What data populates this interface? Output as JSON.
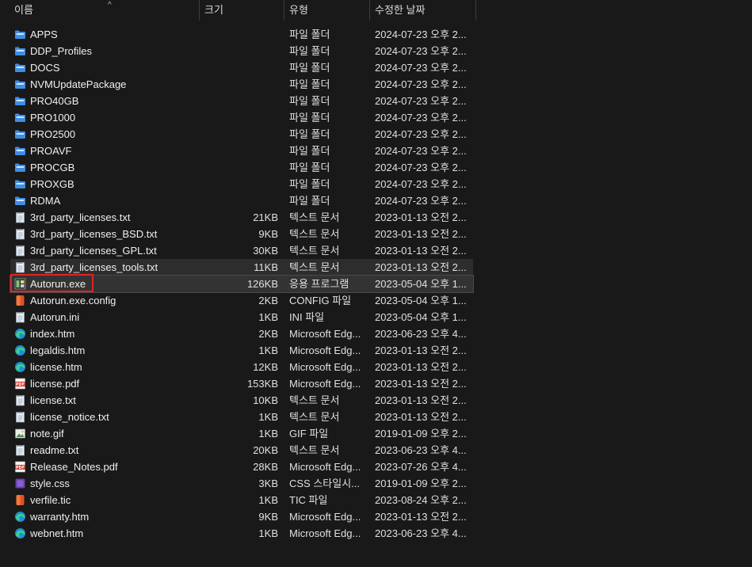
{
  "columns": {
    "name": "이름",
    "size": "크기",
    "type": "유형",
    "date": "수정한 날짜",
    "sort_indicator": "^"
  },
  "colors": {
    "folder": "#4a90e2",
    "highlight_border": "#e02424",
    "selected_bg": "#333333"
  },
  "files": [
    {
      "name": "APPS",
      "size": "",
      "type": "파일 폴더",
      "date": "2024-07-23 오후 2...",
      "icon": "folder-icon"
    },
    {
      "name": "DDP_Profiles",
      "size": "",
      "type": "파일 폴더",
      "date": "2024-07-23 오후 2...",
      "icon": "folder-icon"
    },
    {
      "name": "DOCS",
      "size": "",
      "type": "파일 폴더",
      "date": "2024-07-23 오후 2...",
      "icon": "folder-icon"
    },
    {
      "name": "NVMUpdatePackage",
      "size": "",
      "type": "파일 폴더",
      "date": "2024-07-23 오후 2...",
      "icon": "folder-icon"
    },
    {
      "name": "PRO40GB",
      "size": "",
      "type": "파일 폴더",
      "date": "2024-07-23 오후 2...",
      "icon": "folder-icon"
    },
    {
      "name": "PRO1000",
      "size": "",
      "type": "파일 폴더",
      "date": "2024-07-23 오후 2...",
      "icon": "folder-icon"
    },
    {
      "name": "PRO2500",
      "size": "",
      "type": "파일 폴더",
      "date": "2024-07-23 오후 2...",
      "icon": "folder-icon"
    },
    {
      "name": "PROAVF",
      "size": "",
      "type": "파일 폴더",
      "date": "2024-07-23 오후 2...",
      "icon": "folder-icon"
    },
    {
      "name": "PROCGB",
      "size": "",
      "type": "파일 폴더",
      "date": "2024-07-23 오후 2...",
      "icon": "folder-icon"
    },
    {
      "name": "PROXGB",
      "size": "",
      "type": "파일 폴더",
      "date": "2024-07-23 오후 2...",
      "icon": "folder-icon"
    },
    {
      "name": "RDMA",
      "size": "",
      "type": "파일 폴더",
      "date": "2024-07-23 오후 2...",
      "icon": "folder-icon"
    },
    {
      "name": "3rd_party_licenses.txt",
      "size": "21KB",
      "type": "텍스트 문서",
      "date": "2023-01-13 오전 2...",
      "icon": "text-file-icon"
    },
    {
      "name": "3rd_party_licenses_BSD.txt",
      "size": "9KB",
      "type": "텍스트 문서",
      "date": "2023-01-13 오전 2...",
      "icon": "text-file-icon"
    },
    {
      "name": "3rd_party_licenses_GPL.txt",
      "size": "30KB",
      "type": "텍스트 문서",
      "date": "2023-01-13 오전 2...",
      "icon": "text-file-icon"
    },
    {
      "name": "3rd_party_licenses_tools.txt",
      "size": "11KB",
      "type": "텍스트 문서",
      "date": "2023-01-13 오전 2...",
      "icon": "text-file-icon",
      "state": "hover"
    },
    {
      "name": "Autorun.exe",
      "size": "126KB",
      "type": "응용 프로그램",
      "date": "2023-05-04 오후 1...",
      "icon": "application-icon",
      "state": "selected",
      "highlighted": true
    },
    {
      "name": "Autorun.exe.config",
      "size": "2KB",
      "type": "CONFIG 파일",
      "date": "2023-05-04 오후 1...",
      "icon": "config-file-icon"
    },
    {
      "name": "Autorun.ini",
      "size": "1KB",
      "type": "INI 파일",
      "date": "2023-05-04 오후 1...",
      "icon": "text-file-icon"
    },
    {
      "name": "index.htm",
      "size": "2KB",
      "type": "Microsoft Edg...",
      "date": "2023-06-23 오후 4...",
      "icon": "edge-icon"
    },
    {
      "name": "legaldis.htm",
      "size": "1KB",
      "type": "Microsoft Edg...",
      "date": "2023-01-13 오전 2...",
      "icon": "edge-icon"
    },
    {
      "name": "license.htm",
      "size": "12KB",
      "type": "Microsoft Edg...",
      "date": "2023-01-13 오전 2...",
      "icon": "edge-icon"
    },
    {
      "name": "license.pdf",
      "size": "153KB",
      "type": "Microsoft Edg...",
      "date": "2023-01-13 오전 2...",
      "icon": "pdf-icon"
    },
    {
      "name": "license.txt",
      "size": "10KB",
      "type": "텍스트 문서",
      "date": "2023-01-13 오전 2...",
      "icon": "text-file-icon"
    },
    {
      "name": "license_notice.txt",
      "size": "1KB",
      "type": "텍스트 문서",
      "date": "2023-01-13 오전 2...",
      "icon": "text-file-icon"
    },
    {
      "name": "note.gif",
      "size": "1KB",
      "type": "GIF 파일",
      "date": "2019-01-09 오후 2...",
      "icon": "image-icon"
    },
    {
      "name": "readme.txt",
      "size": "20KB",
      "type": "텍스트 문서",
      "date": "2023-06-23 오후 4...",
      "icon": "text-file-icon"
    },
    {
      "name": "Release_Notes.pdf",
      "size": "28KB",
      "type": "Microsoft Edg...",
      "date": "2023-07-26 오후 4...",
      "icon": "pdf-icon"
    },
    {
      "name": "style.css",
      "size": "3KB",
      "type": "CSS 스타일시...",
      "date": "2019-01-09 오후 2...",
      "icon": "css-file-icon"
    },
    {
      "name": "verfile.tic",
      "size": "1KB",
      "type": "TIC 파일",
      "date": "2023-08-24 오후 2...",
      "icon": "config-file-icon"
    },
    {
      "name": "warranty.htm",
      "size": "9KB",
      "type": "Microsoft Edg...",
      "date": "2023-01-13 오전 2...",
      "icon": "edge-icon"
    },
    {
      "name": "webnet.htm",
      "size": "1KB",
      "type": "Microsoft Edg...",
      "date": "2023-06-23 오후 4...",
      "icon": "edge-icon"
    }
  ]
}
